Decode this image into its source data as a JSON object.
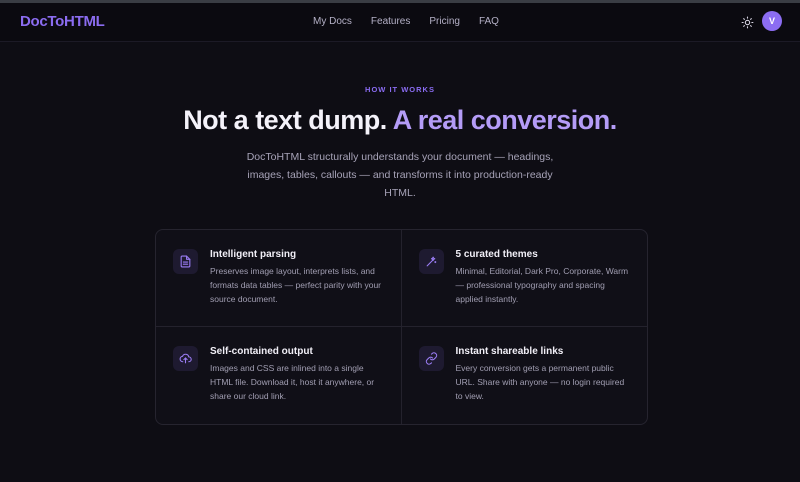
{
  "nav": {
    "logo": "DocToHTML",
    "links": [
      {
        "label": "My Docs"
      },
      {
        "label": "Features"
      },
      {
        "label": "Pricing"
      },
      {
        "label": "FAQ"
      }
    ],
    "theme_icon": "sun-icon",
    "avatar_initial": "V"
  },
  "hero": {
    "eyebrow": "HOW IT WORKS",
    "headline_main": "Not a text dump.",
    "headline_accent": "A real conversion.",
    "subtitle": "DocToHTML structurally understands your document — headings, images, tables, callouts — and transforms it into production-ready HTML."
  },
  "features": [
    {
      "icon": "document-icon",
      "title": "Intelligent parsing",
      "text": "Preserves image layout, interprets lists, and formats data tables — perfect parity with your source document."
    },
    {
      "icon": "wand-icon",
      "title": "5 curated themes",
      "text": "Minimal, Editorial, Dark Pro, Corporate, Warm — professional typography and spacing applied instantly."
    },
    {
      "icon": "cloud-upload-icon",
      "title": "Self-contained output",
      "text": "Images and CSS are inlined into a single HTML file. Download it, host it anywhere, or share our cloud link."
    },
    {
      "icon": "link-icon",
      "title": "Instant shareable links",
      "text": "Every conversion gets a permanent public URL. Share with anyone — no login required to view."
    }
  ],
  "colors": {
    "accent": "#8b6cf0",
    "accent_light": "#b49cf7",
    "background": "#0e0d14"
  }
}
